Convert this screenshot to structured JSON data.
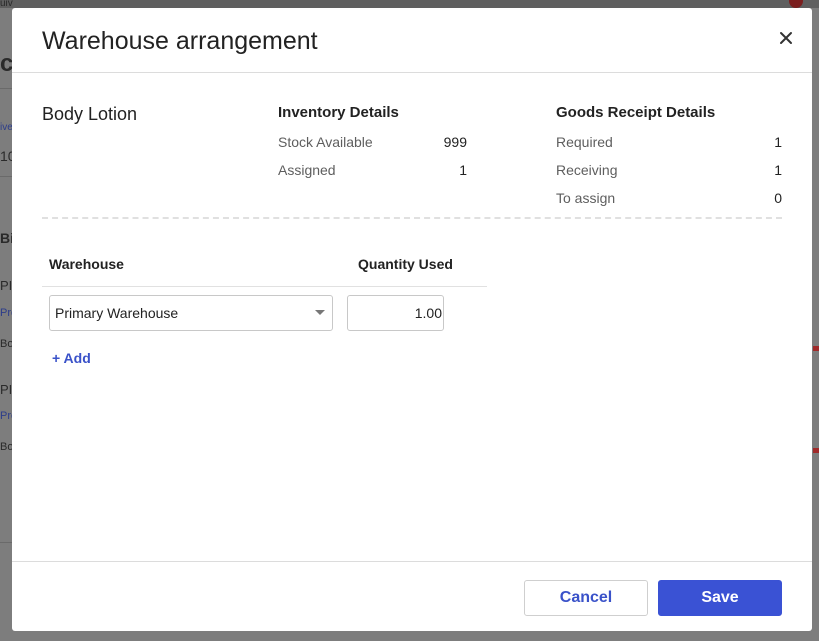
{
  "background": {
    "fragments": [
      "uiv",
      "c",
      "ive",
      "10",
      "Bil",
      "PI-",
      "Pro",
      "Bo",
      "PI-",
      "Pro",
      "Bo"
    ]
  },
  "modal": {
    "title": "Warehouse arrangement",
    "close_icon": "close-icon",
    "product_name": "Body Lotion",
    "inventory": {
      "title": "Inventory Details",
      "rows": [
        {
          "label": "Stock Available",
          "value": "999"
        },
        {
          "label": "Assigned",
          "value": "1"
        }
      ]
    },
    "goods_receipt": {
      "title": "Goods Receipt Details",
      "rows": [
        {
          "label": "Required",
          "value": "1"
        },
        {
          "label": "Receiving",
          "value": "1"
        },
        {
          "label": "To assign",
          "value": "0"
        }
      ]
    },
    "table": {
      "headers": {
        "warehouse": "Warehouse",
        "quantity": "Quantity Used"
      },
      "rows": [
        {
          "warehouse": "Primary Warehouse",
          "quantity": "1.00"
        }
      ]
    },
    "add_label": "+ Add",
    "footer": {
      "cancel_label": "Cancel",
      "save_label": "Save"
    },
    "colors": {
      "accent": "#3a52d4",
      "link": "#3a52c9"
    }
  }
}
